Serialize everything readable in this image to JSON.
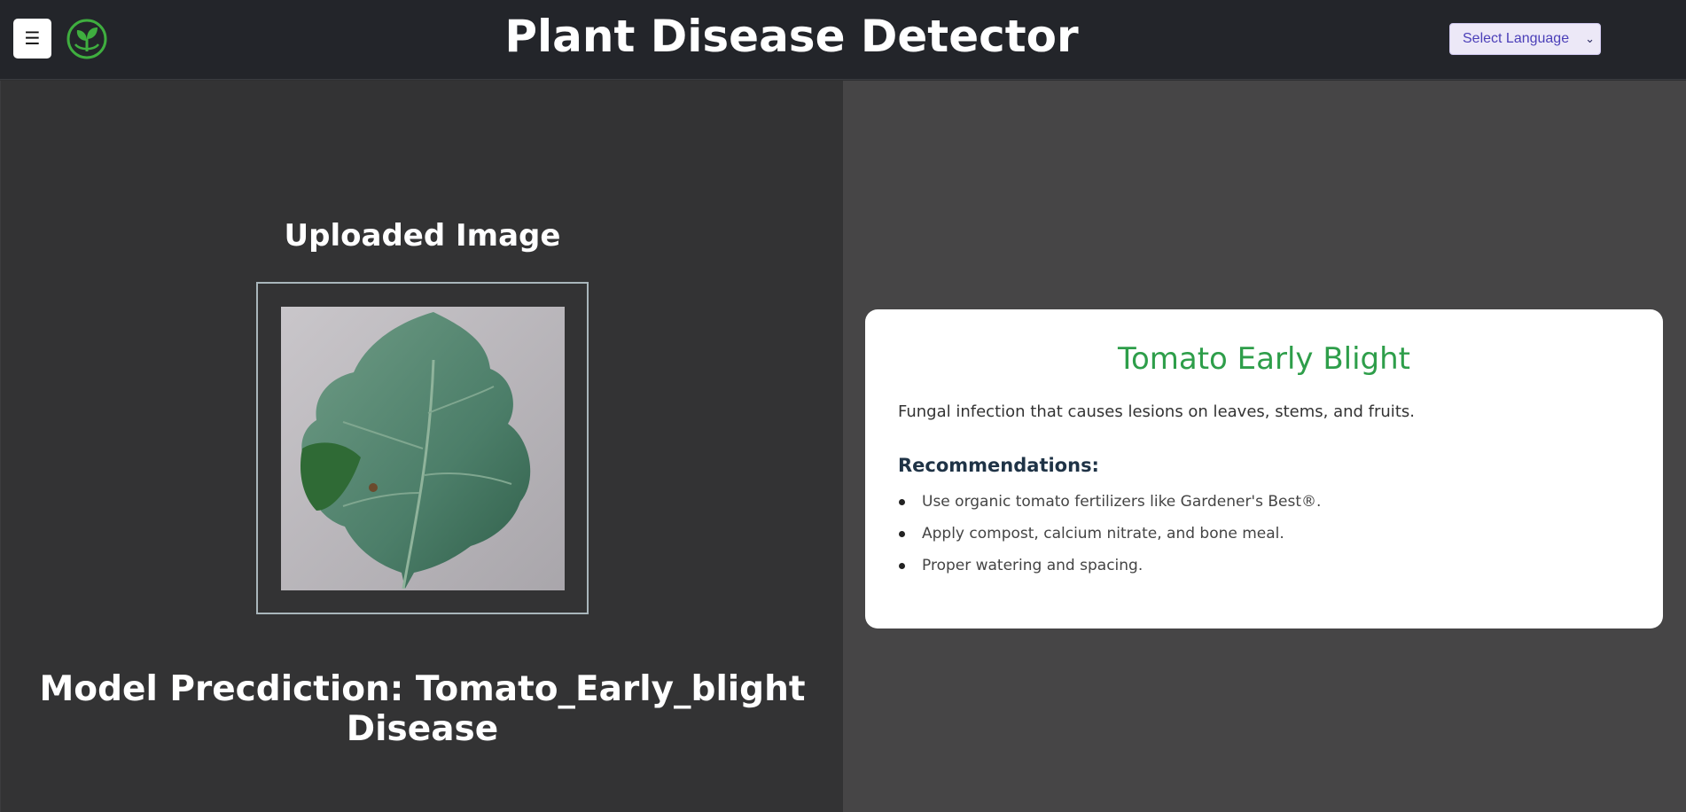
{
  "header": {
    "menu_icon_glyph": "☰",
    "title": "Plant Disease Detector",
    "language_select": {
      "selected": "Select Language"
    },
    "logo_icon": "leaf-logo-icon"
  },
  "upload": {
    "heading": "Uploaded Image",
    "image_alt": "tomato-leaf-photo"
  },
  "prediction": {
    "text": "Model Precdiction: Tomato_Early_blight Disease"
  },
  "result_card": {
    "title": "Tomato Early Blight",
    "description": "Fungal infection that causes lesions on leaves, stems, and fruits.",
    "recommendations_heading": "Recommendations:",
    "recommendations": [
      "Use organic tomato fertilizers like Gardener's Best®.",
      "Apply compost, calcium nitrate, and bone meal.",
      "Proper watering and spacing."
    ]
  },
  "colors": {
    "header_bg": "#23252a",
    "left_panel_bg": "#333334",
    "right_panel_bg": "#464546",
    "accent_green": "#2e9e4a",
    "select_text": "#4b3fb8"
  }
}
